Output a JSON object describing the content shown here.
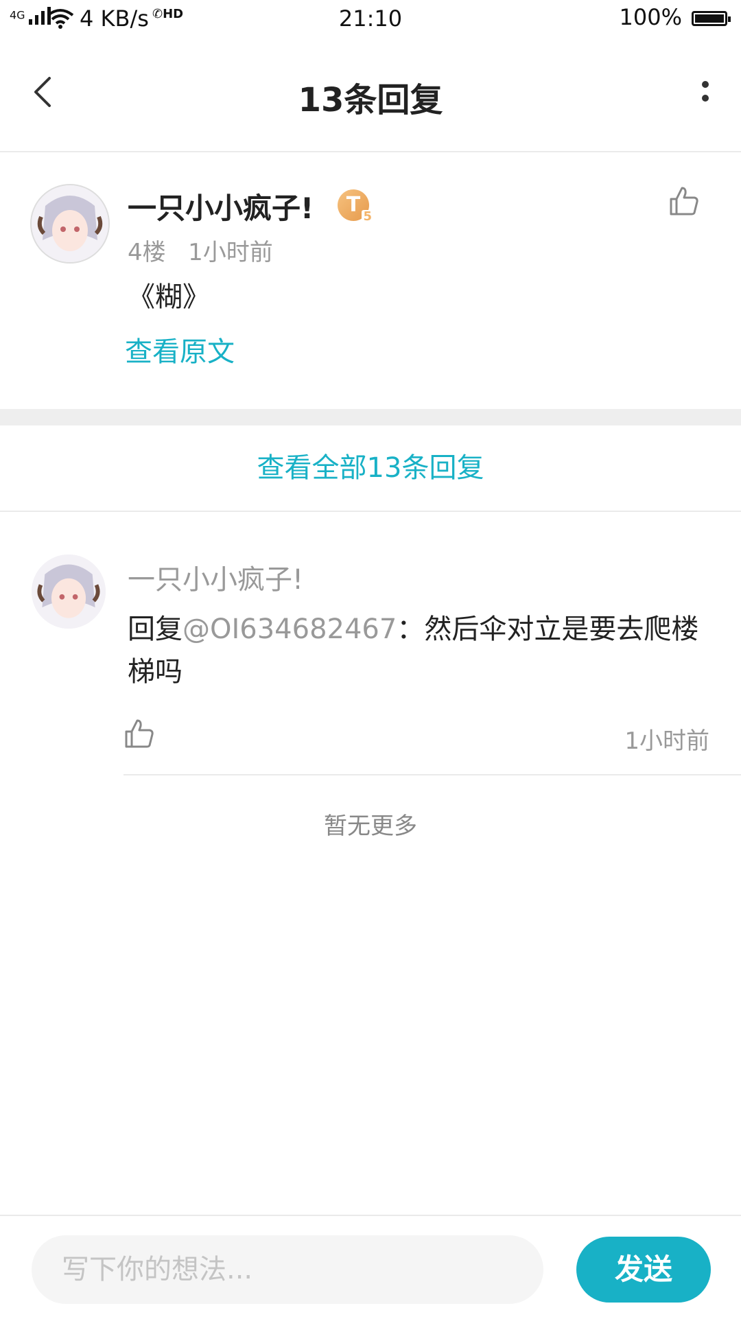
{
  "status_bar": {
    "network": "4G",
    "speed": "4 KB/s",
    "hd": "HD",
    "time": "21:10",
    "battery": "100%"
  },
  "header": {
    "title": "13条回复"
  },
  "original_post": {
    "username": "一只小小疯子!",
    "badge": "T",
    "badge_level": "5",
    "floor": "4楼",
    "time": "1小时前",
    "content": "《糊》",
    "view_original": "查看原文"
  },
  "view_all": "查看全部13条回复",
  "reply": {
    "username": "一只小小疯子!",
    "prefix": "回复",
    "mention": "@OI634682467",
    "content": "：然后伞对立是要去爬楼梯吗",
    "time": "1小时前"
  },
  "no_more": "暂无更多",
  "composer": {
    "placeholder": "写下你的想法...",
    "send_label": "发送"
  },
  "colors": {
    "accent": "#18b1c6",
    "muted": "#999999"
  }
}
